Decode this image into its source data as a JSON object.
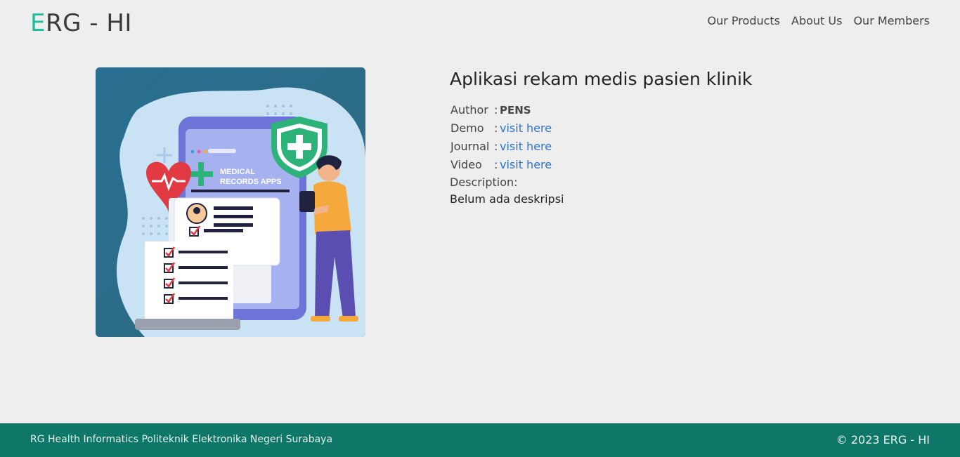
{
  "header": {
    "logo_accent": "E",
    "logo_rest": "RG - HI",
    "nav": [
      {
        "label": "Our Products"
      },
      {
        "label": "About Us"
      },
      {
        "label": "Our Members"
      }
    ]
  },
  "product": {
    "image_caption": "MEDICAL RECORDS APPS",
    "title": "Aplikasi rekam medis pasien klinik",
    "meta": [
      {
        "label": "Author",
        "value": "PENS"
      },
      {
        "label": "Demo",
        "value": "visit here"
      },
      {
        "label": "Journal",
        "value": "visit here"
      },
      {
        "label": "Video",
        "value": "visit here"
      }
    ],
    "colon": ":",
    "description_label": "Description:",
    "description": "Belum ada deskripsi"
  },
  "footer": {
    "left": "RG Health Informatics Politeknik Elektronika Negeri Surabaya",
    "right": "© 2023 ERG - HI"
  },
  "colors": {
    "accent": "#1abc9c",
    "footer_bg": "#0f7768",
    "link": "#2b73c4"
  }
}
